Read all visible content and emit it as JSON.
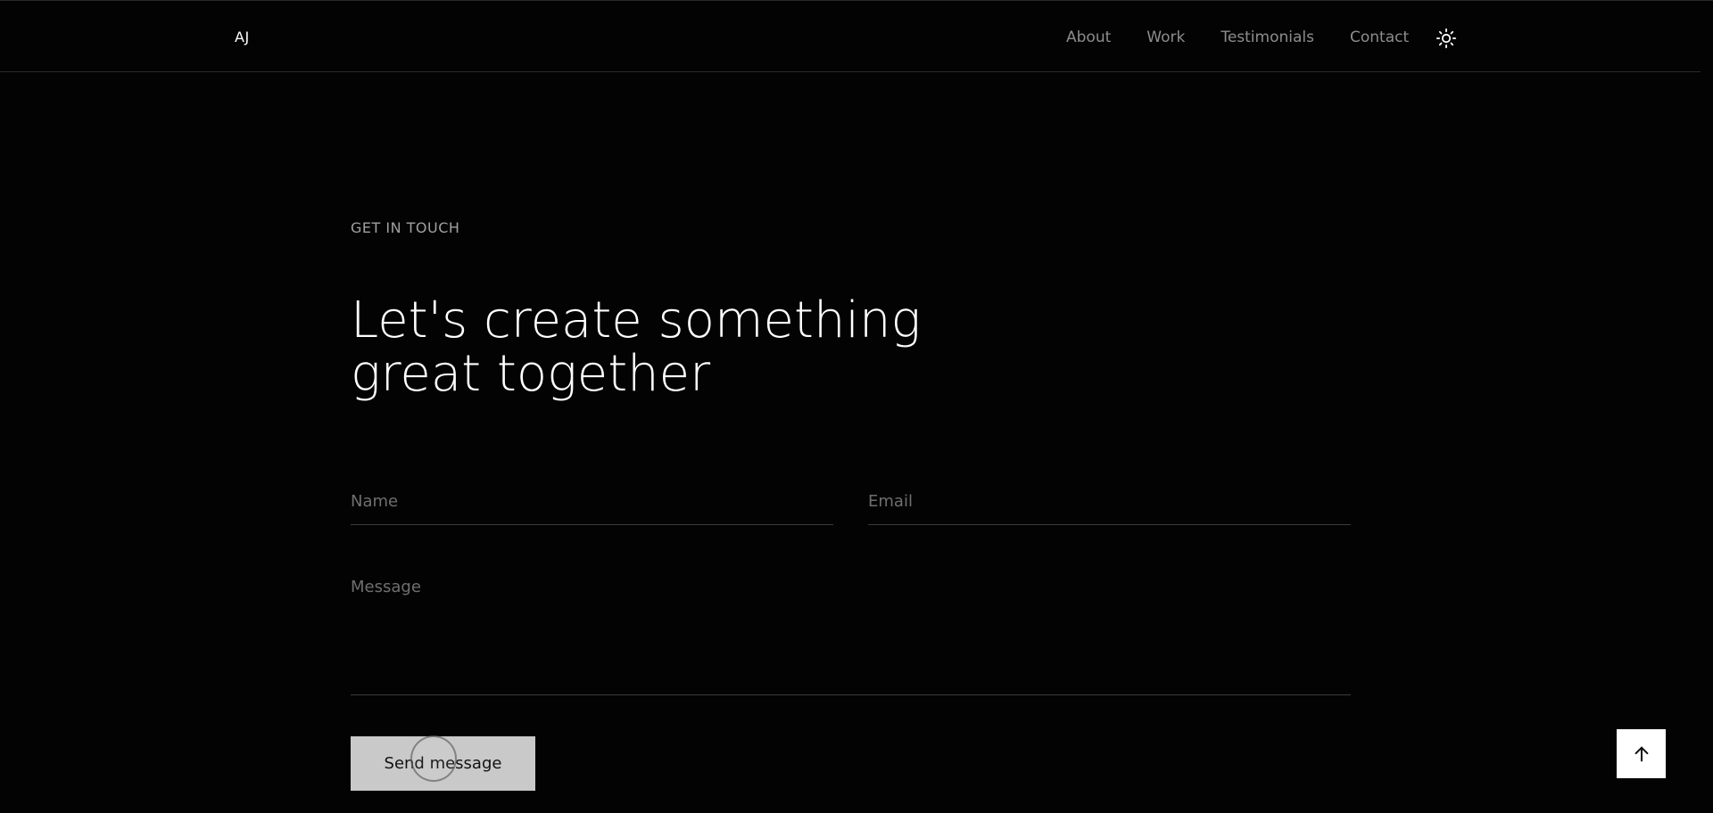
{
  "header": {
    "brand": "AJ",
    "nav": [
      {
        "label": "About"
      },
      {
        "label": "Work"
      },
      {
        "label": "Testimonials"
      },
      {
        "label": "Contact"
      }
    ],
    "theme_icon": "sun-icon"
  },
  "contact": {
    "eyebrow": "GET IN TOUCH",
    "title": "Let's create something great together",
    "name_placeholder": "Name",
    "email_placeholder": "Email",
    "message_placeholder": "Message",
    "send_label": "Send message"
  },
  "back_to_top": {
    "icon": "arrow-up-icon"
  },
  "colors": {
    "background": "#030303",
    "muted_text": "#8d8d8d",
    "button_bg": "#c9c9c9"
  }
}
